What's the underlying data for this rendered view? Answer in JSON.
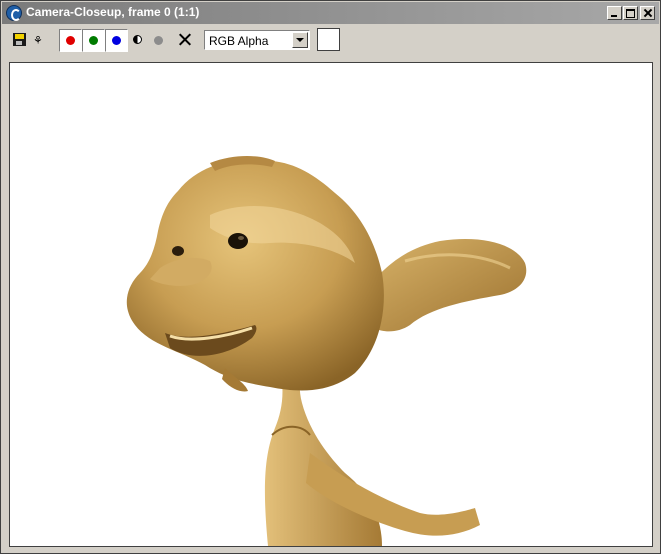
{
  "window": {
    "title": "Camera-Closeup, frame 0 (1:1)"
  },
  "toolbar": {
    "display_options": [
      "RGB Alpha"
    ],
    "selected_display": "RGB Alpha"
  },
  "colors": {
    "title_bar": "#8a8a8a",
    "chrome": "#d4d0c8",
    "red_channel": "#e00000",
    "green_channel": "#007b00",
    "blue_channel": "#0000e0",
    "swatch": "#ffffff",
    "render_background": "#ffffff",
    "character_skin": "#c9a054"
  }
}
